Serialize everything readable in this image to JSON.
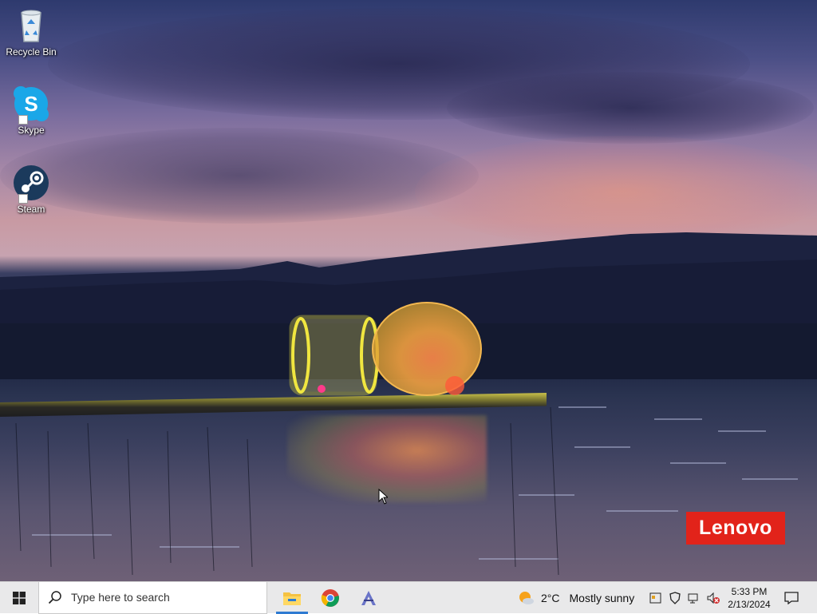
{
  "desktop": {
    "icons": [
      {
        "label": "Recycle Bin",
        "icon": "recycle-bin-icon"
      },
      {
        "label": "Skype",
        "icon": "skype-icon"
      },
      {
        "label": "Steam",
        "icon": "steam-icon"
      }
    ],
    "brand_badge": {
      "text": "Lenovo",
      "color": "#e2231a"
    }
  },
  "taskbar": {
    "search_placeholder": "Type here to search",
    "pinned_apps": [
      {
        "name": "File Explorer",
        "icon": "file-explorer-icon",
        "active": true
      },
      {
        "name": "Google Chrome",
        "icon": "chrome-icon",
        "active": false
      },
      {
        "name": "App",
        "icon": "app-a-icon",
        "active": false
      }
    ],
    "weather": {
      "temp": "2°C",
      "condition": "Mostly sunny"
    },
    "clock": {
      "time": "5:33 PM",
      "date": "2/13/2024"
    },
    "accent": "#2e7ad1"
  }
}
